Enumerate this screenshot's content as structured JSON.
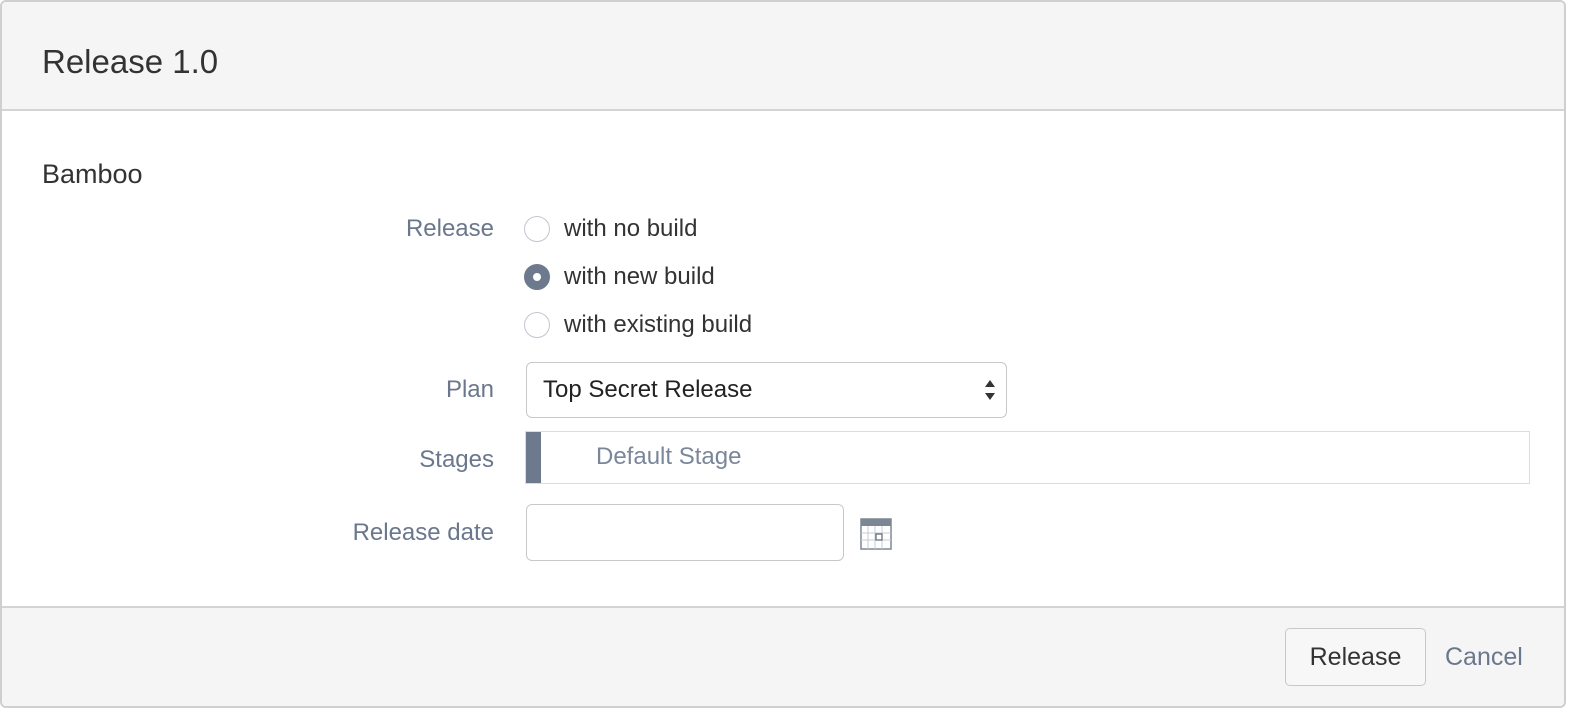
{
  "dialog": {
    "title": "Release 1.0"
  },
  "section": {
    "title": "Bamboo"
  },
  "form": {
    "release_label": "Release",
    "release_options": [
      {
        "label": "with no build",
        "checked": false
      },
      {
        "label": "with new build",
        "checked": true
      },
      {
        "label": "with existing build",
        "checked": false
      }
    ],
    "plan_label": "Plan",
    "plan_selected": "Top Secret Release",
    "stages_label": "Stages",
    "stages_value": "Default Stage",
    "release_date_label": "Release date",
    "release_date_value": ""
  },
  "footer": {
    "release_button": "Release",
    "cancel_link": "Cancel"
  },
  "icons": {
    "select": "up-down-arrows-icon",
    "date_picker": "calendar-icon"
  },
  "colors": {
    "accent": "#6d7a8d",
    "label": "#6b778c",
    "header_bg": "#f5f5f5"
  }
}
